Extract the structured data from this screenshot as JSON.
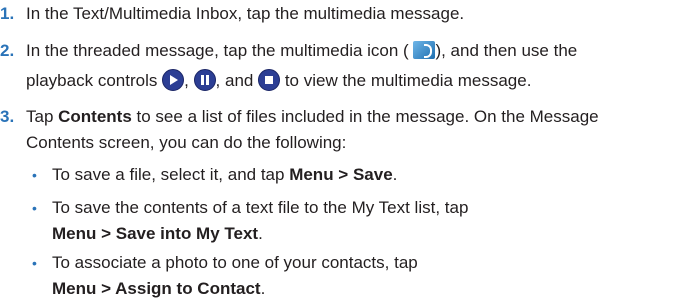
{
  "steps": [
    {
      "number": "1.",
      "lines": [
        "In the Text/Multimedia Inbox, tap the multimedia message."
      ]
    },
    {
      "number": "2.",
      "line1_before": "In the threaded message, tap the multimedia icon (",
      "line1_after": "), and then use the",
      "line2_before": "playback controls",
      "line2_sep1": ",",
      "line2_sep2": ", and",
      "line2_after": "to view the multimedia message."
    },
    {
      "number": "3.",
      "line1_a": "Tap ",
      "line1_bold": "Contents",
      "line1_b": " to see a list of files included in the message. On the Message",
      "line2": "Contents screen, you can do the following:"
    }
  ],
  "bullets": [
    {
      "pre": "To save a file, select it, and tap ",
      "bold": "Menu > Save",
      "post": "."
    },
    {
      "line1": "To save the contents of a text file to the My Text list, tap",
      "bold": "Menu > Save into My Text",
      "post": "."
    },
    {
      "line1": "To associate a photo to one of your contacts, tap",
      "bold": "Menu > Assign to Contact",
      "post": "."
    }
  ],
  "icons": {
    "multimedia": "multimedia-icon",
    "play": "play-icon",
    "pause": "pause-icon",
    "stop": "stop-icon"
  },
  "colors": {
    "accent": "#2a73b8",
    "text": "#231f20",
    "control": "#2c3e94"
  }
}
